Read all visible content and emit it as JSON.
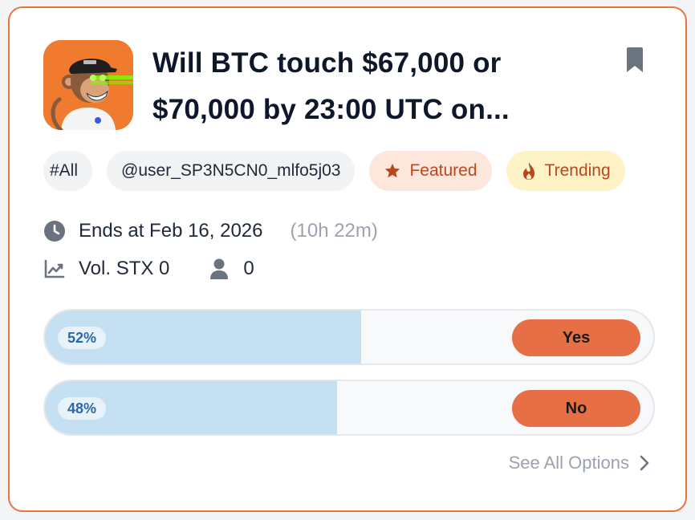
{
  "market": {
    "title": "Will BTC touch $67,000 or $70,000 by 23:00 UTC on..."
  },
  "tags": [
    {
      "label": "#All"
    },
    {
      "label": "@user_SP3N5CN0_mlfo5j03"
    },
    {
      "label": "Featured",
      "icon": "star-icon"
    },
    {
      "label": "Trending",
      "icon": "flame-icon"
    }
  ],
  "meta": {
    "ends_label": "Ends at Feb 16, 2026",
    "remaining": "(10h 22m)",
    "volume": "Vol. STX 0",
    "participants": "0"
  },
  "options": [
    {
      "pct_label": "52%",
      "pct": 52,
      "button": "Yes"
    },
    {
      "pct_label": "48%",
      "pct": 48,
      "button": "No"
    }
  ],
  "see_all": "See All Options",
  "colors": {
    "accent": "#e66f45",
    "border": "#e8743f",
    "fill": "#c5dff3",
    "featured_bg": "#fde6dc",
    "trending_bg": "#fdf3c7"
  }
}
